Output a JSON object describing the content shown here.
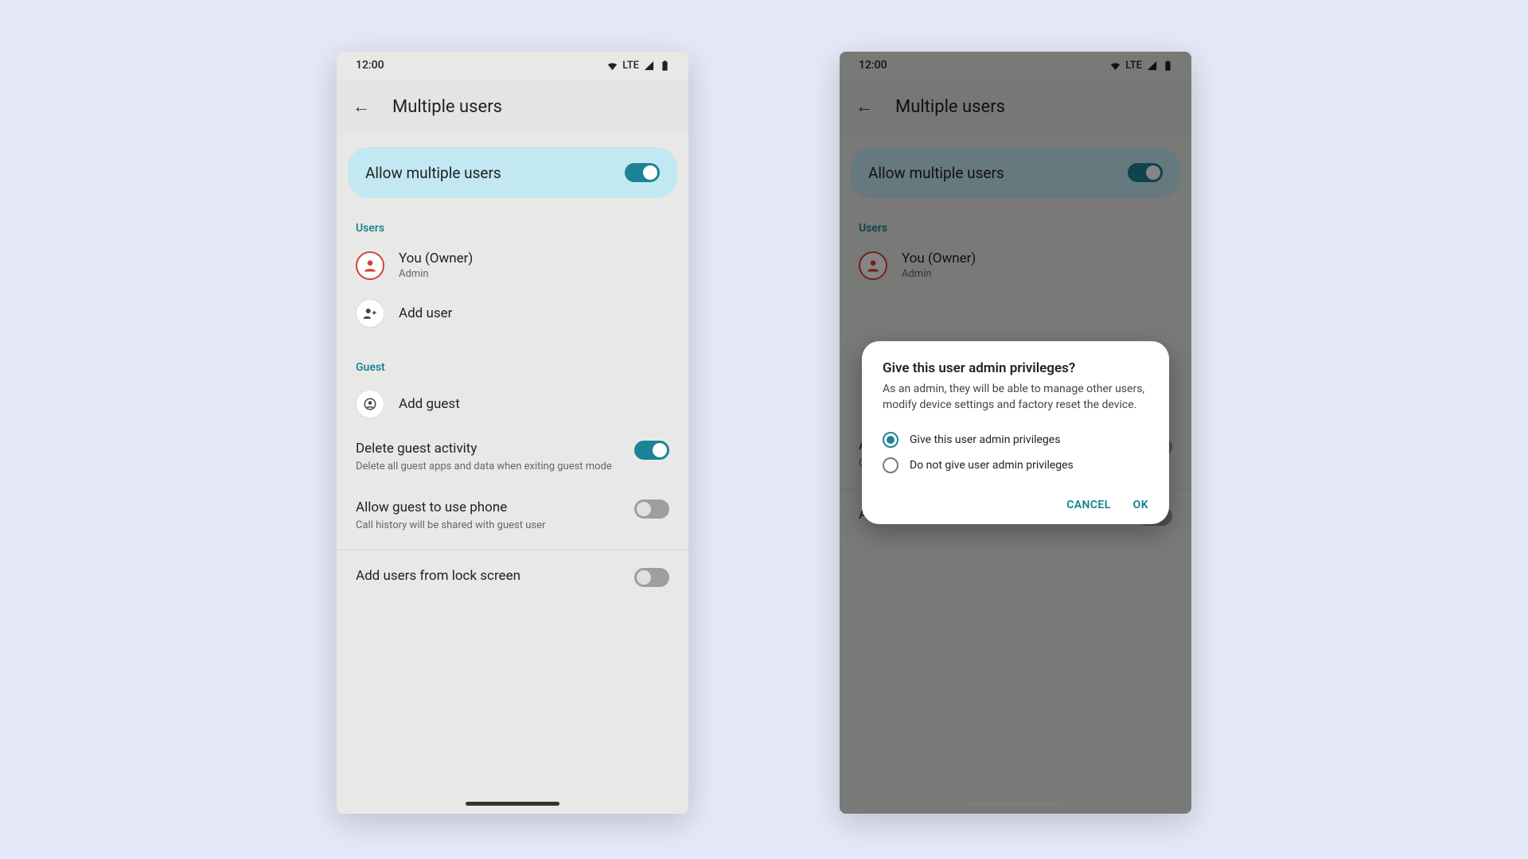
{
  "statusbar": {
    "time": "12:00",
    "network": "LTE"
  },
  "appbar": {
    "title": "Multiple users"
  },
  "hero": {
    "label": "Allow multiple users",
    "on": true
  },
  "sections": {
    "users_label": "Users",
    "guest_label": "Guest"
  },
  "users": {
    "owner": {
      "name": "You (Owner)",
      "role": "Admin"
    },
    "add_user_label": "Add user"
  },
  "guest": {
    "add_guest_label": "Add guest"
  },
  "settings": {
    "delete_guest": {
      "title": "Delete guest activity",
      "sub": "Delete all guest apps and data when exiting guest mode",
      "on": true
    },
    "allow_phone": {
      "title": "Allow guest to use phone",
      "sub": "Call history will be shared with guest user",
      "on": false
    },
    "lock_screen": {
      "title": "Add users from lock screen",
      "on": false
    }
  },
  "dialog": {
    "title": "Give this user admin privileges?",
    "body": "As an admin, they will be able to manage other users, modify device settings and factory reset the device.",
    "option_give": "Give this user admin privileges",
    "option_deny": "Do not give user admin privileges",
    "cancel": "CANCEL",
    "ok": "OK"
  }
}
